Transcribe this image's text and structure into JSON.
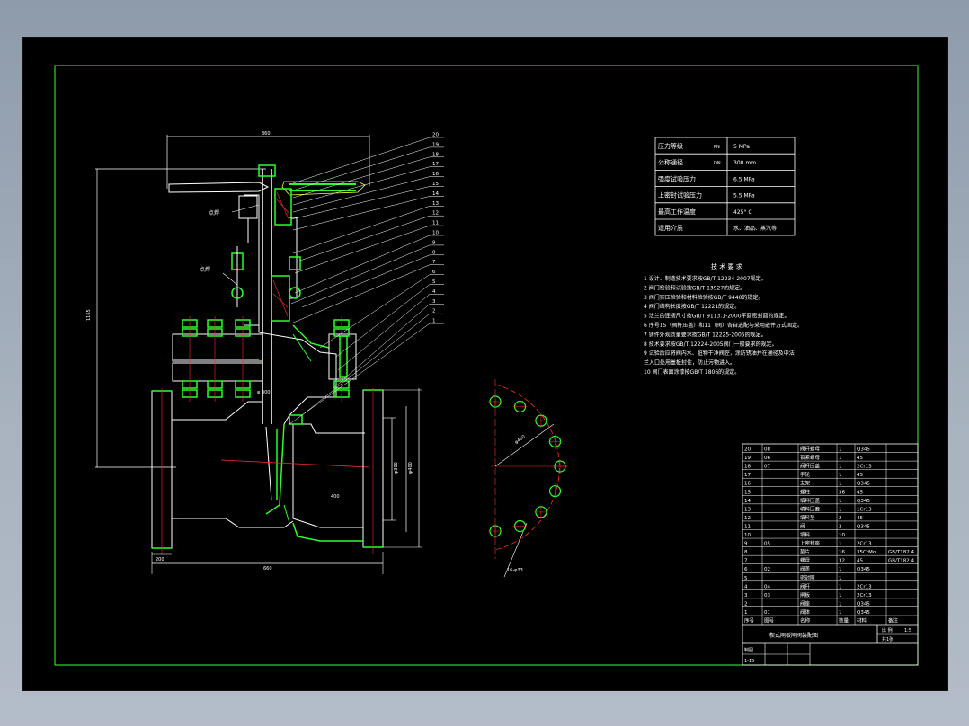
{
  "drawing": {
    "title": "楔式闸板闸阀装配图",
    "part_numbers": [
      "20",
      "19",
      "18",
      "17",
      "16",
      "15",
      "14",
      "13",
      "12",
      "11",
      "10",
      "9",
      "8",
      "7",
      "6",
      "5",
      "4",
      "3",
      "2",
      "1"
    ],
    "callouts": {
      "handwheel_label": "点焊",
      "packing_label": "点焊"
    },
    "dimensions": {
      "top_width": "360",
      "overall_height": "1165",
      "body_length": "660",
      "flange_dia": "200"
    }
  },
  "spec_table": {
    "rows": [
      {
        "label": "压力等级",
        "code": "PN",
        "value": "5 MPa"
      },
      {
        "label": "公称通径",
        "code": "DN",
        "value": "300 mm"
      },
      {
        "label": "强度试验压力",
        "code": "",
        "value": "6.5 MPa"
      },
      {
        "label": "上密封试验压力",
        "code": "",
        "value": "5.5 MPa"
      },
      {
        "label": "最高工作温度",
        "code": "",
        "value": "425° C"
      },
      {
        "label": "适用介质",
        "code": "",
        "value": "水、油品、蒸汽等"
      }
    ]
  },
  "tech_requirements": {
    "heading": "技 术 要 求",
    "items": [
      "1 设计、制造技术要求按GB/T 12234-2007规定。",
      "2 阀门检验和试验按GB/T 13927的规定。",
      "3 阀门实压检验和材料检验按GB/T 9440的规定。",
      "4 阀门结构长度按GB/T 12221的规定。",
      "5 法兰的连接尺寸按GB/T 9113.1-2000平面密封面的规定。",
      "6 序号15（阀杆压盖）和11（阀）各自选配与采用嵌件方式固定。",
      "7 铸件外观质量要求按GB/T 12225-2005的规定。",
      "8 技术要求按GB/T 12224-2005阀门一般要求的规定。",
      "9 试验后应将阀内水、脏物干净阀腔，涂防锈油并在通径及中法",
      "  兰入口处用盖板封住，防止污物进入。",
      "10 阀门表面涂漆按GB/T 1806的规定。"
    ]
  },
  "bom": {
    "rows": [
      [
        "20",
        "08",
        "阀杆螺母",
        "1",
        "Q345",
        ""
      ],
      [
        "19",
        "06",
        "锁紧螺母",
        "1",
        "45",
        ""
      ],
      [
        "18",
        "07",
        "阀杆压盖",
        "1",
        "2Cr13",
        ""
      ],
      [
        "17",
        "",
        "手轮",
        "1",
        "45",
        ""
      ],
      [
        "16",
        "",
        "支架",
        "1",
        "Q345",
        ""
      ],
      [
        "15",
        "",
        "螺柱",
        "36",
        "45",
        ""
      ],
      [
        "14",
        "",
        "填料压盖",
        "1",
        "Q345",
        ""
      ],
      [
        "13",
        "",
        "填料压套",
        "1",
        "1Cr13",
        ""
      ],
      [
        "12",
        "",
        "填料垫",
        "2",
        "45",
        ""
      ],
      [
        "11",
        "",
        "阀",
        "2",
        "Q345",
        ""
      ],
      [
        "10",
        "",
        "填料",
        "10",
        "",
        ""
      ],
      [
        "9",
        "05",
        "上密封座",
        "1",
        "2Cr13",
        ""
      ],
      [
        "8",
        "",
        "垫片",
        "16",
        "35CrMo",
        "GB/T182.4"
      ],
      [
        "7",
        "",
        "螺母",
        "32",
        "45",
        "GB/T182.4"
      ],
      [
        "6",
        "02",
        "阀盖",
        "1",
        "Q345",
        ""
      ],
      [
        "5",
        "",
        "密封圈",
        "1",
        "",
        ""
      ],
      [
        "4",
        "04",
        "阀杆",
        "1",
        "2Cr13",
        ""
      ],
      [
        "3",
        "03",
        "闸板",
        "1",
        "2Cr13",
        ""
      ],
      [
        "2",
        "",
        "阀座",
        "1",
        "Q345",
        ""
      ],
      [
        "1",
        "01",
        "阀体",
        "1",
        "Q345",
        ""
      ]
    ],
    "header": [
      "序号",
      "图号",
      "名称",
      "数量",
      "材料",
      "备注"
    ],
    "title": "楔式闸板闸阀装配图",
    "scale_label": "比 例",
    "scale_value": "1:5",
    "sheet_label": "共1张",
    "drawn_label": "制图",
    "checked_label": "1-15"
  },
  "colors": {
    "frame": "#39ff39",
    "line": "#ffffff",
    "part": "#2bff2b",
    "red": "#ff2b2b",
    "cyan": "#00ffff"
  }
}
